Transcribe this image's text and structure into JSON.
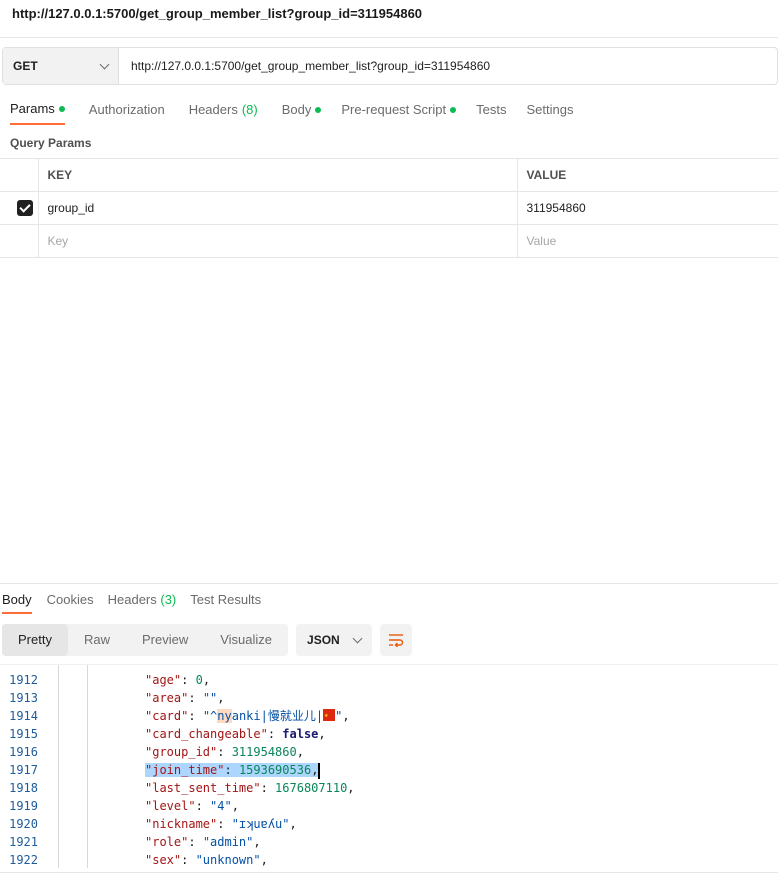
{
  "title_url": "http://127.0.0.1:5700/get_group_member_list?group_id=311954860",
  "request": {
    "method": "GET",
    "url": "http://127.0.0.1:5700/get_group_member_list?group_id=311954860"
  },
  "tabs": {
    "params": "Params",
    "authorization": "Authorization",
    "headers": "Headers",
    "headers_count": "(8)",
    "body": "Body",
    "prerequest": "Pre-request Script",
    "tests": "Tests",
    "settings": "Settings"
  },
  "query_params": {
    "label": "Query Params",
    "col_key": "KEY",
    "col_value": "VALUE",
    "rows": [
      {
        "key": "group_id",
        "value": "311954860",
        "checked": true
      }
    ],
    "placeholder_key": "Key",
    "placeholder_value": "Value"
  },
  "response": {
    "tabs": {
      "body": "Body",
      "cookies": "Cookies",
      "headers": "Headers",
      "headers_count": "(3)",
      "test_results": "Test Results"
    },
    "views": [
      "Pretty",
      "Raw",
      "Preview",
      "Visualize"
    ],
    "active_view": "Pretty",
    "format": "JSON",
    "lines": [
      {
        "no": "1912",
        "key": "\"age\"",
        "value": "0",
        "type": "n"
      },
      {
        "no": "1913",
        "key": "\"area\"",
        "value": "\"\"",
        "type": "s"
      },
      {
        "no": "1914",
        "key": "\"card\"",
        "value": "\"^nyanki|慢就业儿|",
        "type": "card"
      },
      {
        "no": "1915",
        "key": "\"card_changeable\"",
        "value": "false",
        "type": "b"
      },
      {
        "no": "1916",
        "key": "\"group_id\"",
        "value": "311954860",
        "type": "n"
      },
      {
        "no": "1917",
        "key": "\"join_time\"",
        "value": "1593690536",
        "type": "sel"
      },
      {
        "no": "1918",
        "key": "\"last_sent_time\"",
        "value": "1676807110",
        "type": "n"
      },
      {
        "no": "1919",
        "key": "\"level\"",
        "value": "\"4\"",
        "type": "s"
      },
      {
        "no": "1920",
        "key": "\"nickname\"",
        "value": "\"ɪʞuɐʎu\"",
        "type": "s"
      },
      {
        "no": "1921",
        "key": "\"role\"",
        "value": "\"admin\"",
        "type": "s"
      },
      {
        "no": "1922",
        "key": "\"sex\"",
        "value": "\"unknown\"",
        "type": "s"
      }
    ]
  },
  "colors": {
    "accent": "#ff6c37",
    "status_dot": "#0cbb52"
  }
}
